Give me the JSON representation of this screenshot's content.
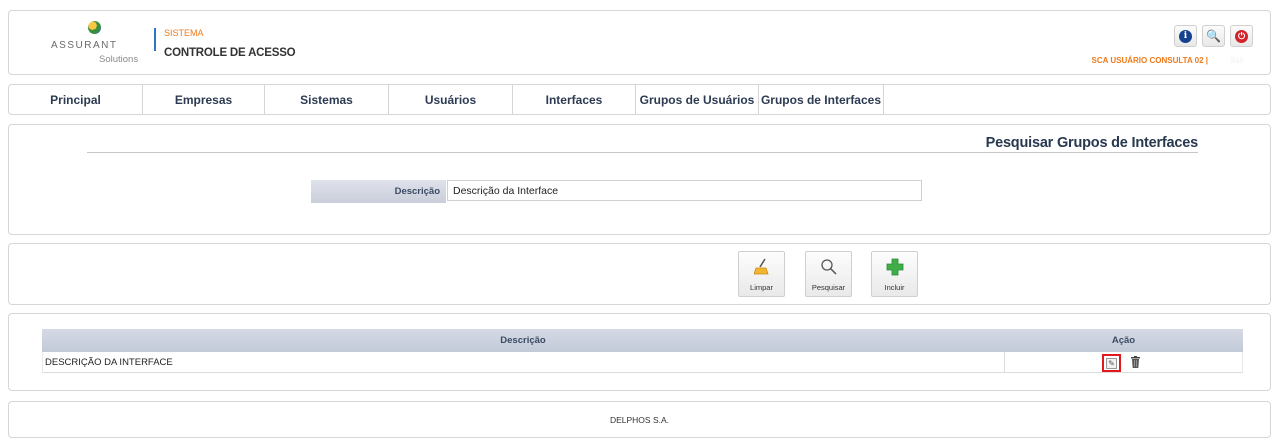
{
  "header": {
    "logo_name": "ASSURANT",
    "logo_sub": "Solutions",
    "system_label": "SISTEMA",
    "system_name": "CONTROLE DE ACESSO",
    "user_line": "SCA USUÁRIO CONSULTA 02  |",
    "buttons": [
      {
        "icon": "info-icon",
        "glyph": "i"
      },
      {
        "icon": "key-icon",
        "glyph": "🔍"
      },
      {
        "icon": "power-icon",
        "glyph": "⏻"
      }
    ],
    "colors": {
      "accent_orange": "#f07a1a",
      "brand_blue": "#2a77c6",
      "navy_text": "#27384f"
    }
  },
  "nav": {
    "items": [
      {
        "label": "Principal"
      },
      {
        "label": "Empresas"
      },
      {
        "label": "Sistemas"
      },
      {
        "label": "Usuários"
      },
      {
        "label": "Interfaces"
      },
      {
        "label": "Grupos de Usuários"
      },
      {
        "label": "Grupos de Interfaces"
      }
    ]
  },
  "search": {
    "title": "Pesquisar Grupos de Interfaces",
    "field_label": "Descrição",
    "field_value": "Descrição da Interface"
  },
  "actions": {
    "buttons": [
      {
        "label": "Limpar",
        "icon": "broom-icon"
      },
      {
        "label": "Pesquisar",
        "icon": "magnifier-icon"
      },
      {
        "label": "Incluir",
        "icon": "plus-icon"
      }
    ]
  },
  "results": {
    "columns": [
      "Descrição",
      "Ação"
    ],
    "rows": [
      {
        "descricao": "DESCRIÇÃO DA INTERFACE",
        "actions": [
          "edit-icon",
          "trash-icon"
        ]
      }
    ]
  },
  "footer": {
    "text": "DELPHOS S.A."
  }
}
